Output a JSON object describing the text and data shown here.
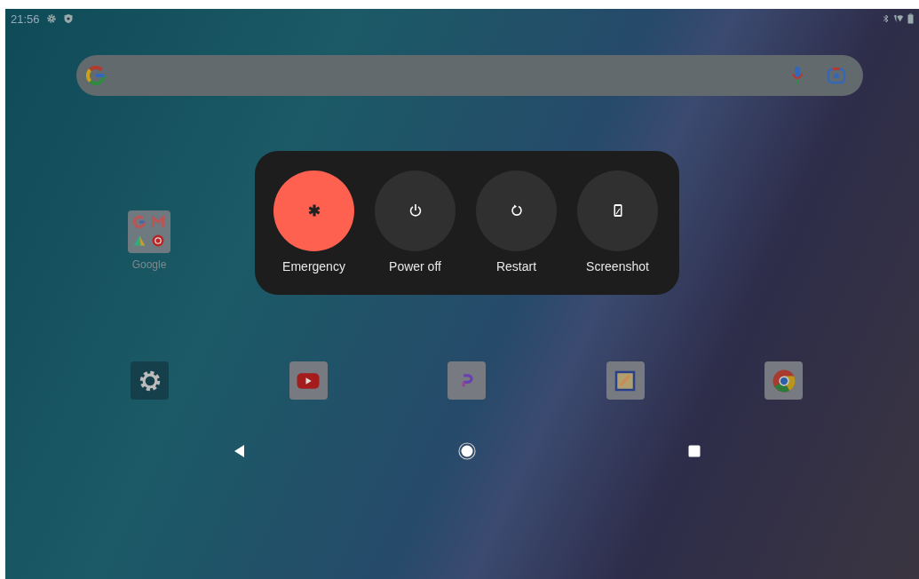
{
  "status_bar": {
    "time": "21:56"
  },
  "power_menu": [
    {
      "kind": "emergency",
      "label": "Emergency",
      "color": "#ff6150"
    },
    {
      "kind": "power",
      "label": "Power off",
      "color": "#303030"
    },
    {
      "kind": "restart",
      "label": "Restart",
      "color": "#303030"
    },
    {
      "kind": "screenshot",
      "label": "Screenshot",
      "color": "#303030"
    }
  ],
  "folder": {
    "label": "Google"
  },
  "dock": [
    {
      "kind": "settings"
    },
    {
      "kind": "video"
    },
    {
      "kind": "letter"
    },
    {
      "kind": "notes"
    },
    {
      "kind": "browser"
    }
  ]
}
